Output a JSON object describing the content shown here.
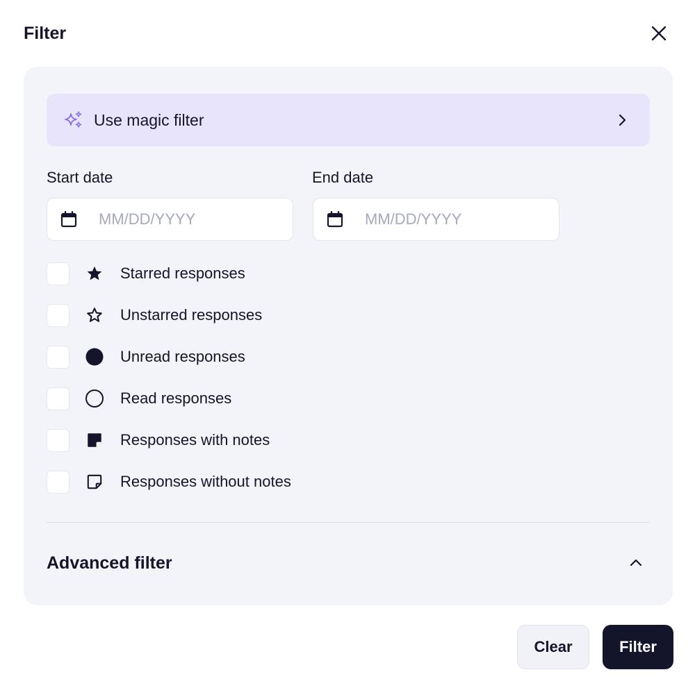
{
  "header": {
    "title": "Filter"
  },
  "magic_filter": {
    "label": "Use magic filter",
    "accent": "#8b6cf0",
    "background": "#e8e4fc"
  },
  "start_date": {
    "label": "Start date",
    "placeholder": "MM/DD/YYYY",
    "value": ""
  },
  "end_date": {
    "label": "End date",
    "placeholder": "MM/DD/YYYY",
    "value": ""
  },
  "options": [
    {
      "label": "Starred responses",
      "icon": "star-filled-icon",
      "checked": false
    },
    {
      "label": "Unstarred responses",
      "icon": "star-outline-icon",
      "checked": false
    },
    {
      "label": "Unread responses",
      "icon": "circle-filled-icon",
      "checked": false
    },
    {
      "label": "Read responses",
      "icon": "circle-outline-icon",
      "checked": false
    },
    {
      "label": "Responses with notes",
      "icon": "note-filled-icon",
      "checked": false
    },
    {
      "label": "Responses without notes",
      "icon": "note-outline-icon",
      "checked": false
    }
  ],
  "advanced": {
    "label": "Advanced filter",
    "expanded": true
  },
  "footer": {
    "clear_label": "Clear",
    "filter_label": "Filter"
  },
  "colors": {
    "text": "#14142b",
    "panel": "#f3f4fa",
    "primary_button": "#14142b"
  }
}
